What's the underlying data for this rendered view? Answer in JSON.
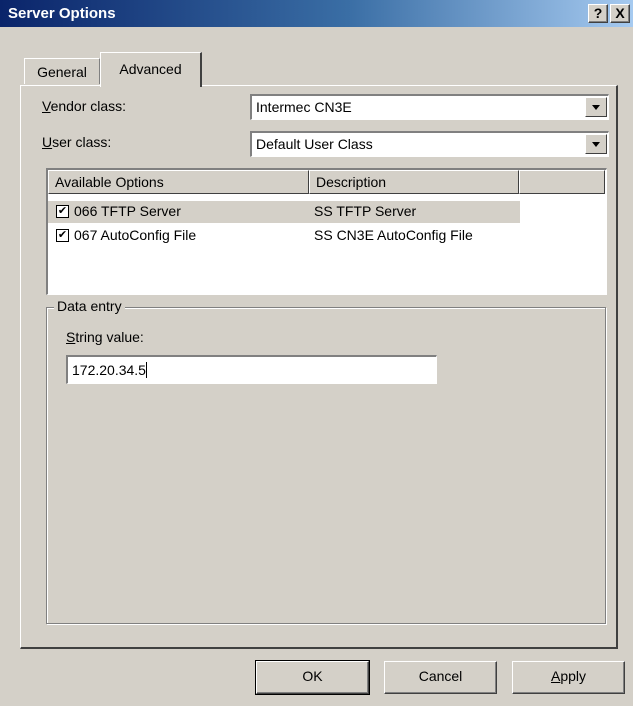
{
  "window": {
    "title": "Server Options",
    "help_glyph": "?",
    "close_glyph": "X"
  },
  "tabs": [
    {
      "label": "General",
      "active": false
    },
    {
      "label": "Advanced",
      "active": true
    }
  ],
  "vendor_class": {
    "label_mnemonic": "V",
    "label_rest": "endor class:",
    "value": "Intermec CN3E"
  },
  "user_class": {
    "label_mnemonic": "U",
    "label_rest": "ser class:",
    "value": "Default User Class"
  },
  "options_list": {
    "columns": [
      "Available Options",
      "Description"
    ],
    "check_glyph": "✔",
    "rows": [
      {
        "name": "066 TFTP Server",
        "description": "SS TFTP Server",
        "checked": true,
        "selected": true
      },
      {
        "name": "067 AutoConfig File",
        "description": "SS CN3E AutoConfig File",
        "checked": true,
        "selected": false
      }
    ]
  },
  "data_entry": {
    "group_title": "Data entry",
    "label_mnemonic": "S",
    "label_rest": "tring value:",
    "value": "172.20.34.5"
  },
  "buttons": {
    "ok": "OK",
    "cancel": "Cancel",
    "apply_mnemonic": "A",
    "apply_rest": "pply"
  },
  "colors": {
    "title_gradient_start": "#0a246a",
    "title_gradient_end": "#a6caf0",
    "face": "#d4d0c8"
  }
}
